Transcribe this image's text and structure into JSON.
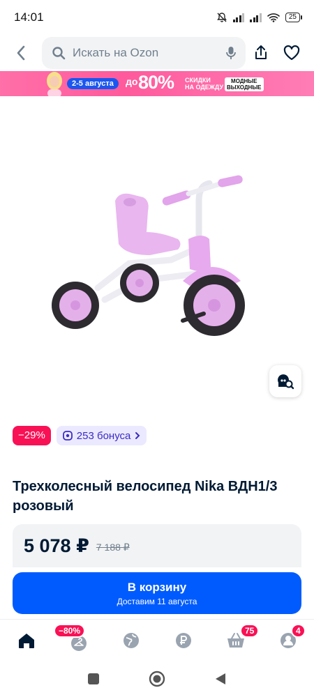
{
  "status_bar": {
    "time": "14:01",
    "battery": "25"
  },
  "search": {
    "placeholder": "Искать на Ozon"
  },
  "banner": {
    "dates": "2-5 августа",
    "upto": "до",
    "percent": "80%",
    "discount_line1": "СКИДКИ",
    "discount_line2": "НА ОДЕЖДУ",
    "weekend_line1": "МОДНЫЕ",
    "weekend_line2": "ВЫХОДНЫЕ"
  },
  "product": {
    "discount_badge": "−29%",
    "bonus_label": "253 бонуса",
    "title": "Трехколесный велосипед Nika ВДН1/3 розовый",
    "price": "5 078 ₽",
    "old_price": "7 188 ₽"
  },
  "cart_button": {
    "label": "В корзину",
    "delivery": "Доставим 11 августа"
  },
  "bottom_nav": {
    "items": [
      {
        "name": "home",
        "badge": ""
      },
      {
        "name": "fashion",
        "badge": "−80%"
      },
      {
        "name": "explore",
        "badge": ""
      },
      {
        "name": "finance",
        "badge": ""
      },
      {
        "name": "cart",
        "badge": "75"
      },
      {
        "name": "profile",
        "badge": "4"
      }
    ]
  },
  "colors": {
    "accent": "#005bff",
    "sale": "#f91155",
    "bonus_bg": "#ebe9ff",
    "bike_pink": "#e8b4ef"
  }
}
